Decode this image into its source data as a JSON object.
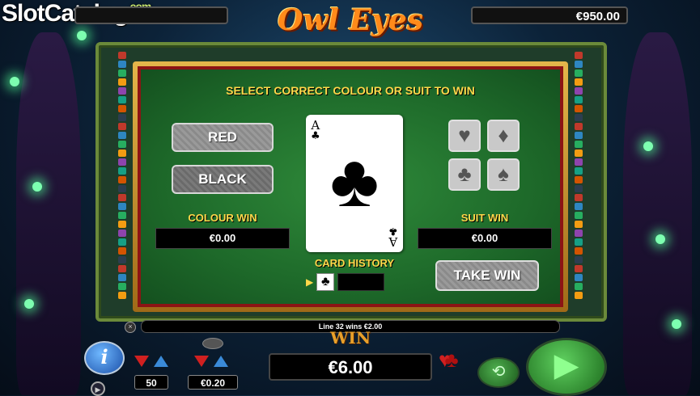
{
  "watermark": {
    "text": "SlotCatalog",
    "suffix": ".com"
  },
  "header": {
    "logo_text": "Owl Eyes",
    "left_box_value": "",
    "balance": "€950.00"
  },
  "gamble": {
    "heading": "SELECT CORRECT COLOUR OR SUIT TO WIN",
    "red_label": "RED",
    "black_label": "BLACK",
    "colour_win_label": "COLOUR WIN",
    "colour_win_value": "€0.00",
    "suit_win_label": "SUIT WIN",
    "suit_win_value": "€0.00",
    "card_rank": "A",
    "card_suit": "♣",
    "card_history_label": "CARD HISTORY",
    "card_history": [
      "♣"
    ],
    "take_win_label": "TAKE WIN",
    "suits": [
      {
        "name": "hearts",
        "glyph": "♥"
      },
      {
        "name": "diamonds",
        "glyph": "♦"
      },
      {
        "name": "clubs",
        "glyph": "♣"
      },
      {
        "name": "spades",
        "glyph": "♠"
      }
    ]
  },
  "bottom": {
    "line_win_text": "Line 32 wins €2.00",
    "win_title": "WIN",
    "win_amount": "€6.00",
    "lines_value": "50",
    "bet_value": "€0.20",
    "info_label": "i"
  },
  "colors": {
    "felt": "#1e6a2a",
    "gold": "#ffd84a",
    "panel_border": "#8c1414"
  }
}
